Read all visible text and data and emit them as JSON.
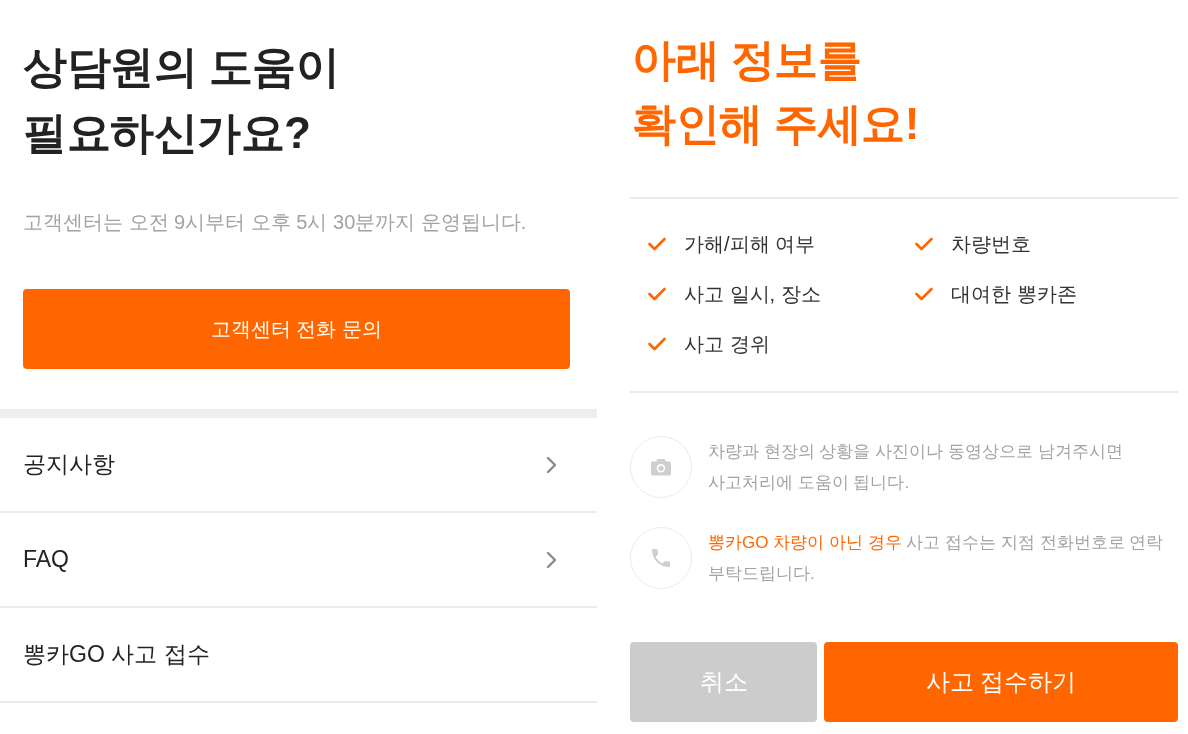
{
  "help_panel": {
    "title_lines": [
      "상담원의 도움이",
      "필요하신가요?"
    ],
    "hours_note": "고객센터는 오전 9시부터 오후 5시 30분까지 운영됩니다.",
    "call_button": "고객센터 전화 문의",
    "menu": [
      {
        "label": "공지사항",
        "chevron": true
      },
      {
        "label": "FAQ",
        "chevron": true
      },
      {
        "label": "뽕카GO 사고 접수",
        "chevron": false
      }
    ]
  },
  "report_panel": {
    "title_lines": [
      "아래 정보를",
      "확인해 주세요!"
    ],
    "checklist": [
      {
        "label": "가해/피해 여부",
        "checked": true
      },
      {
        "label": "차량번호",
        "checked": true
      },
      {
        "label": "사고 일시, 장소",
        "checked": true
      },
      {
        "label": "대여한 뽕카존",
        "checked": true
      },
      {
        "label": "사고 경위",
        "checked": true
      }
    ],
    "notices": [
      {
        "kind": "photo",
        "text": "차량과 현장의 상황을 사진이나 동영상으로 남겨주시면 사고처리에 도움이 됩니다."
      },
      {
        "kind": "phone",
        "highlight": "뽕카GO 차량이 아닌 경우",
        "text": "사고 접수는 지점 전화번호로 연락 부탁드립니다."
      }
    ],
    "buttons": [
      {
        "label": "취소",
        "kind": "secondary"
      },
      {
        "label": "사고 접수하기",
        "kind": "primary"
      }
    ]
  }
}
